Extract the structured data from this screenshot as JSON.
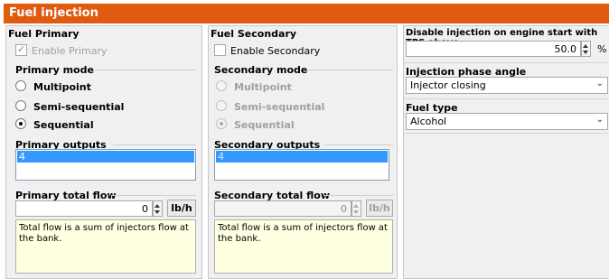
{
  "window": {
    "title": "Fuel injection"
  },
  "primary": {
    "header": "Fuel Primary",
    "enable_label": "Enable Primary",
    "enable_checked": true,
    "mode_label": "Primary mode",
    "modes": [
      "Multipoint",
      "Semi-sequential",
      "Sequential"
    ],
    "selected_mode": "Sequential",
    "outputs_label": "Primary outputs",
    "outputs": [
      "4"
    ],
    "total_flow_label": "Primary total flow",
    "total_flow_value": "0",
    "unit": "lb/h",
    "note": "Total flow is a sum of injectors flow at the bank."
  },
  "secondary": {
    "header": "Fuel Secondary",
    "enable_label": "Enable Secondary",
    "enable_checked": false,
    "mode_label": "Secondary mode",
    "modes": [
      "Multipoint",
      "Semi-sequential",
      "Sequential"
    ],
    "selected_mode": "Sequential",
    "outputs_label": "Secondary outputs",
    "outputs": [
      "4"
    ],
    "total_flow_label": "Secondary total flow",
    "total_flow_value": "0",
    "unit": "lb/h",
    "note": "Total flow is a sum of injectors flow at the bank."
  },
  "right": {
    "disable_tps_label": "Disable injection on engine start with TPS above",
    "disable_tps_value": "50.0",
    "disable_tps_unit": "%",
    "phase_angle_label": "Injection phase angle",
    "phase_angle_value": "Injector closing",
    "fuel_type_label": "Fuel type",
    "fuel_type_value": "Alcohol"
  },
  "colors": {
    "title_bar": "#e05a10",
    "selection": "#3399ff",
    "note_background": "#ffffe1"
  }
}
